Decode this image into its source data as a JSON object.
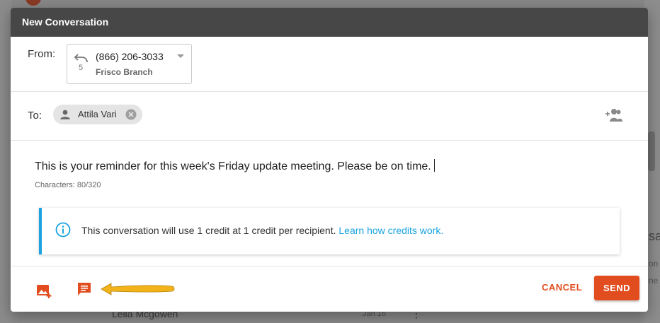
{
  "background": {
    "list_item_name": "Leila Mcgowen",
    "list_item_date": "Jan 16",
    "right_text_1": "sa",
    "right_text_2": "on",
    "right_text_3": "ne"
  },
  "modal": {
    "title": "New Conversation",
    "from": {
      "label": "From:",
      "number": "(866) 206-3033",
      "branch": "Frisco Branch",
      "icon": "forward-call-icon"
    },
    "to": {
      "label": "To:",
      "recipient": "Attila Vari",
      "add_icon": "add-person-icon"
    },
    "message": {
      "text": "This is your reminder for this week's Friday update meeting. Please be on time.",
      "char_count": "Characters: 80/320"
    },
    "info": {
      "text": "This conversation will use 1 credit at 1 credit per recipient.",
      "link": "Learn how credits work."
    },
    "footer": {
      "image_icon": "add-image-icon",
      "template_icon": "message-template-icon",
      "cancel_label": "CANCEL",
      "send_label": "SEND"
    }
  },
  "colors": {
    "accent": "#e14d1f",
    "info": "#1aa3e0",
    "header": "#474747",
    "highlight_arrow": "#f2b21a"
  }
}
